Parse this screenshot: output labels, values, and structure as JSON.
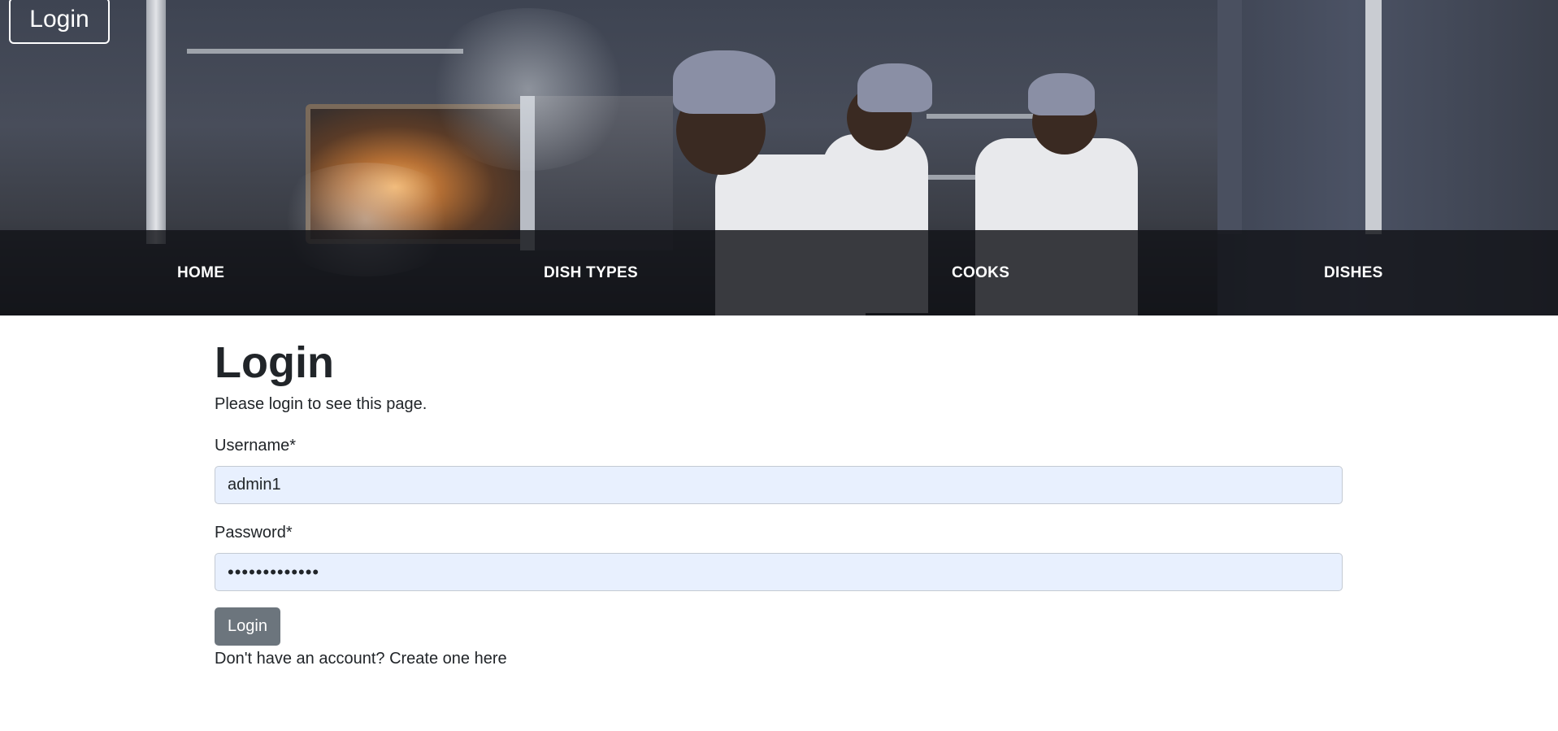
{
  "hero": {
    "login_corner": "Login",
    "nav": [
      {
        "label": "HOME"
      },
      {
        "label": "DISH TYPES"
      },
      {
        "label": "COOKS"
      },
      {
        "label": "DISHES"
      }
    ]
  },
  "form": {
    "title": "Login",
    "subtitle": "Please login to see this page.",
    "username_label": "Username*",
    "username_value": "admin1",
    "password_label": "Password*",
    "password_value": "•••••••••••••",
    "submit_label": "Login",
    "signup_prefix": "Don't have an account? ",
    "signup_link": "Create one here"
  },
  "colors": {
    "input_bg": "#e8f0fe",
    "button_bg": "#6c757d",
    "nav_band": "#121418"
  }
}
